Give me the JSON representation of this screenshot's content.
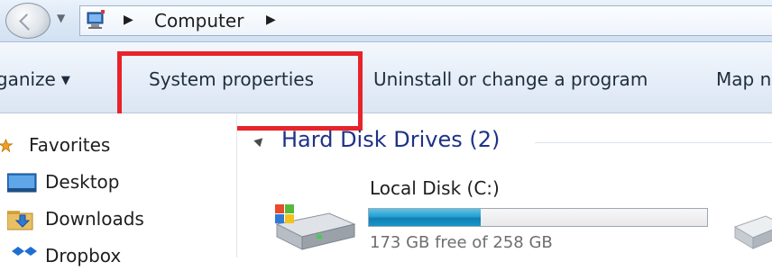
{
  "address_bar": {
    "breadcrumb": [
      "Computer"
    ]
  },
  "toolbar": {
    "organize_label": "rganize",
    "system_properties_label": "System properties",
    "uninstall_label": "Uninstall or change a program",
    "map_label": "Map n"
  },
  "nav": {
    "items": [
      {
        "label": "Favorites",
        "icon": "star-icon"
      },
      {
        "label": "Desktop",
        "icon": "desktop-folder-icon"
      },
      {
        "label": "Downloads",
        "icon": "downloads-folder-icon"
      },
      {
        "label": "Dropbox",
        "icon": "dropbox-icon"
      }
    ]
  },
  "content": {
    "group_title": "Hard Disk Drives (2)",
    "drives": [
      {
        "name": "Local Disk (C:)",
        "free_text": "173 GB free of 258 GB",
        "used_fraction": 0.33
      }
    ]
  },
  "colors": {
    "highlight": "#e8232a",
    "group_title": "#1e3287",
    "drive_bar_fill": "#26a0cf"
  }
}
